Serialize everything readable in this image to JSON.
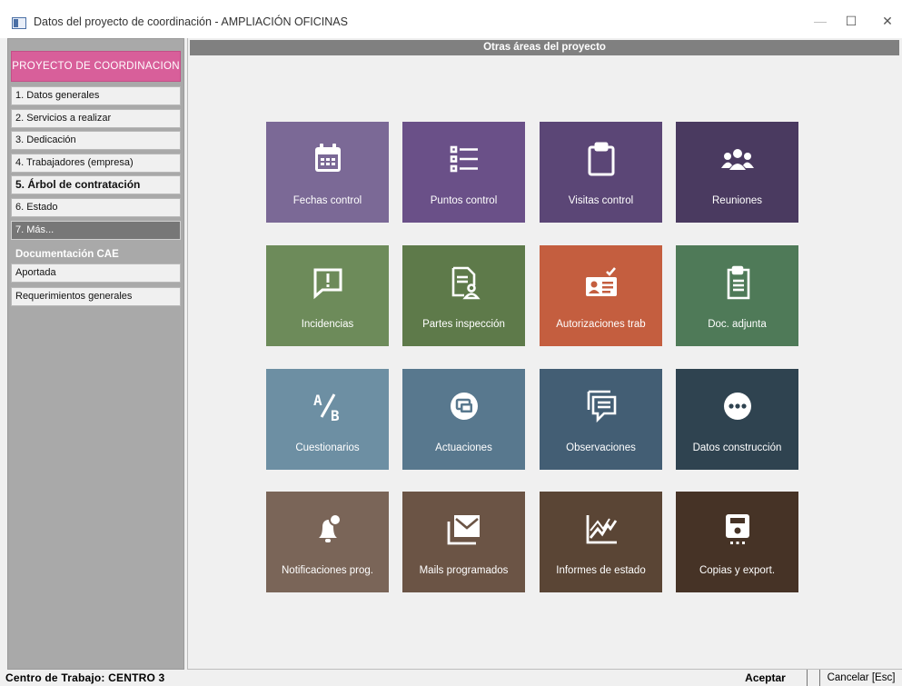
{
  "window": {
    "title": "Datos del proyecto de coordinación - AMPLIACIÓN OFICINAS"
  },
  "window_controls": {
    "minimize": "—",
    "maximize": "☐",
    "close": "✕"
  },
  "sidebar": {
    "header": "PROYECTO DE COORDINACION",
    "items": [
      {
        "label": "1. Datos generales"
      },
      {
        "label": "2. Servicios a realizar"
      },
      {
        "label": "3. Dedicación"
      },
      {
        "label": "4. Trabajadores (empresa)"
      },
      {
        "label": "5. Árbol de contratación"
      },
      {
        "label": "6. Estado"
      },
      {
        "label": "7. Más..."
      }
    ],
    "section_title": "Documentación CAE",
    "cae_items": [
      {
        "label": "Aportada"
      },
      {
        "label": "Requerimientos generales"
      }
    ]
  },
  "main": {
    "header": "Otras áreas del proyecto",
    "tiles": [
      {
        "label": "Fechas control",
        "icon": "calendar-icon",
        "color": "#7b6996"
      },
      {
        "label": "Puntos control",
        "icon": "list-icon",
        "color": "#6a5088"
      },
      {
        "label": "Visitas control",
        "icon": "clipboard-icon",
        "color": "#5b4676"
      },
      {
        "label": "Reuniones",
        "icon": "group-icon",
        "color": "#4a3a60"
      },
      {
        "label": "Incidencias",
        "icon": "alert-message-icon",
        "color": "#6d8b5a"
      },
      {
        "label": "Partes inspección",
        "icon": "document-user-icon",
        "color": "#5e7a4a"
      },
      {
        "label": "Autorizaciones trab",
        "icon": "id-card-check-icon",
        "color": "#c45e3f"
      },
      {
        "label": "Doc. adjunta",
        "icon": "attached-document-icon",
        "color": "#4f7a58"
      },
      {
        "label": "Cuestionarios",
        "icon": "ab-test-icon",
        "color": "#6d8fa3"
      },
      {
        "label": "Actuaciones",
        "icon": "record-circle-icon",
        "color": "#58788e"
      },
      {
        "label": "Observaciones",
        "icon": "comments-icon",
        "color": "#435e74"
      },
      {
        "label": "Datos construcción",
        "icon": "more-circle-icon",
        "color": "#2f4350"
      },
      {
        "label": "Notificaciones prog.",
        "icon": "bell-alert-icon",
        "color": "#7a6558"
      },
      {
        "label": "Mails programados",
        "icon": "mail-stack-icon",
        "color": "#6b5445"
      },
      {
        "label": "Informes de estado",
        "icon": "chart-line-icon",
        "color": "#5a4535"
      },
      {
        "label": "Copias y export.",
        "icon": "floppy-icon",
        "color": "#463326"
      }
    ]
  },
  "status": {
    "centro": "Centro de Trabajo: CENTRO  3",
    "accept": "Aceptar",
    "cancel": "Cancelar [Esc]"
  }
}
